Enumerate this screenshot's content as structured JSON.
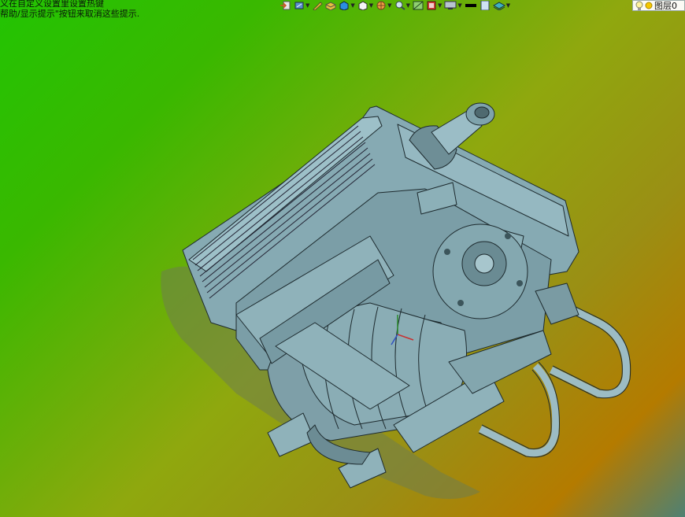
{
  "hints": {
    "line1": "义在自定义设置里设置热键",
    "line2": "帮助/显示提示\"按钮来取消这些提示."
  },
  "toolbar": {
    "items": [
      {
        "icon": "import-icon"
      },
      {
        "icon": "view-orientation-icon"
      },
      {
        "icon": "sketch-pencil-icon"
      },
      {
        "icon": "part-icon"
      },
      {
        "icon": "solid-box-icon"
      },
      {
        "icon": "wireframe-box-icon"
      },
      {
        "icon": "render-sphere-icon"
      },
      {
        "icon": "zoom-view-icon"
      },
      {
        "icon": "section-view-icon"
      },
      {
        "icon": "display-style-icon"
      },
      {
        "icon": "monitor-icon"
      },
      {
        "icon": "line-color-icon"
      },
      {
        "icon": "page-icon"
      },
      {
        "icon": "layers-stack-icon"
      }
    ],
    "layer_label": "图层0"
  },
  "colors": {
    "model_fill": "#7fa3ac",
    "model_stroke": "#1d2a2e",
    "shadow": "#6f7e4e"
  }
}
